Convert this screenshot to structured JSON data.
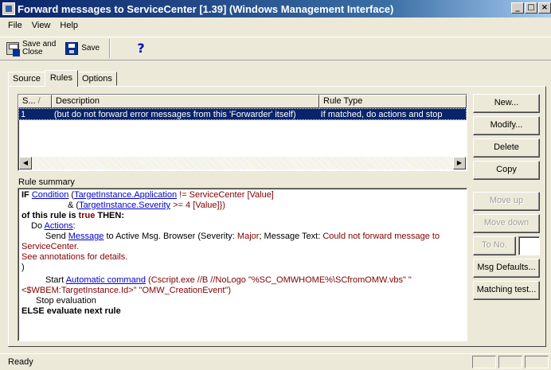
{
  "window": {
    "title": "Forward messages to ServiceCenter [1.39]  (Windows Management Interface)",
    "minimize_label": "_",
    "maximize_label": "□",
    "close_label": "×"
  },
  "menu": {
    "file": "File",
    "view": "View",
    "help": "Help"
  },
  "toolbar": {
    "save_close_line1": "Save and",
    "save_close_line2": "Close",
    "save": "Save",
    "help_glyph": "?"
  },
  "tabs": {
    "source": "Source",
    "rules": "Rules",
    "options": "Options"
  },
  "rules_list": {
    "columns": {
      "sequence": "S...",
      "sort_glyph": "/",
      "description": "Description",
      "rule_type": "Rule Type"
    },
    "rows": [
      {
        "sequence": "1",
        "description": "(but do not forward error messages from this 'Forwarder' itself)",
        "rule_type": "If matched, do actions and stop"
      }
    ],
    "scroll_left": "◀",
    "scroll_right": "▶"
  },
  "buttons": {
    "new": "New...",
    "modify": "Modify...",
    "delete": "Delete",
    "copy": "Copy",
    "move_up": "Move up",
    "move_down": "Move down",
    "to_no": "To No.",
    "msg_defaults": "Msg Defaults...",
    "matching_test": "Matching test..."
  },
  "summary": {
    "label": "Rule summary",
    "if": "IF",
    "condition_link": "Condition",
    "open_paren": "(",
    "target_app_link": "TargetInstance.Application",
    "cond1_rest": " != ServiceCenter  [Value]",
    "amp": "& (",
    "target_sev_link": "TargetInstance.Severity",
    "cond2_rest": " >= 4  [Value]})",
    "of_this_rule_is": "of this rule is",
    "true": "true",
    "then": "THEN:",
    "do": "Do",
    "actions_link": "Actions",
    "colon": ":",
    "send": "Send",
    "message_link": "Message",
    "send_rest": "to Active Msg. Browser (Severity:",
    "severity_value": "Major",
    "message_text_label": ";  Message Text:",
    "message_text_value": "Could not forward message to ServiceCenter.",
    "see_annotations": "See annotations for details.",
    "close_paren": ")",
    "start": "Start",
    "automatic_command_link": "Automatic command",
    "command_open": "(",
    "command_value": "Cscript.exe //B //NoLogo \"%SC_OMWHOME%\\SCfromOMW.vbs\" \"<$WBEM:TargetInstance.Id>\" \"OMW_CreationEvent\"",
    "command_close": ")",
    "stop_evaluation": "Stop evaluation",
    "else": "ELSE evaluate next rule"
  },
  "status": {
    "text": "Ready"
  }
}
